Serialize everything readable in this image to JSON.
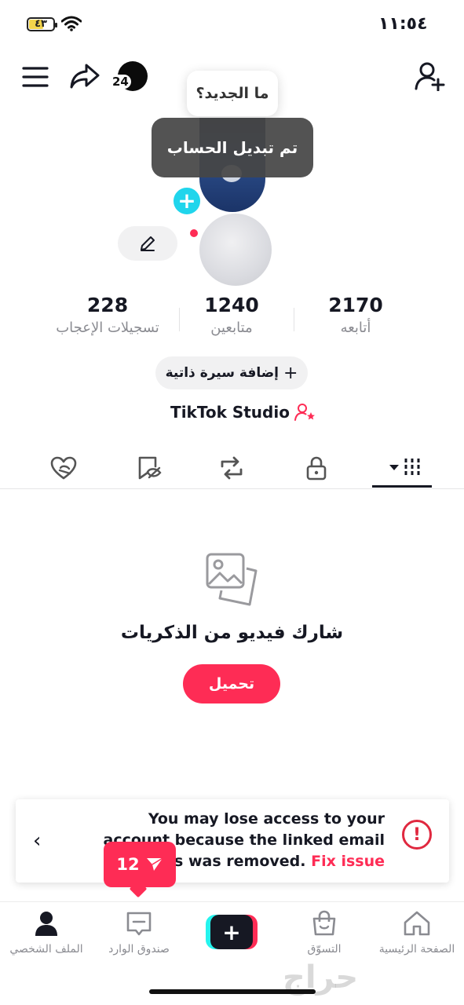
{
  "status_bar": {
    "time": "١١:٥٤",
    "battery": "٤٣"
  },
  "header": {
    "unread_count": "24"
  },
  "profile": {
    "whats_new": "ما الجديد؟",
    "toast": "تم تبديل الحساب"
  },
  "stats": [
    {
      "value": "228",
      "label": "تسجيلات الإعجاب"
    },
    {
      "value": "1240",
      "label": "متابعين"
    },
    {
      "value": "2170",
      "label": "أتابعه"
    }
  ],
  "bio_button": "إضافة سيرة ذاتية",
  "studio_label": "TikTok Studio",
  "empty_state": {
    "title": "شارك فيديو من الذكريات",
    "button": "تحميل"
  },
  "banner": {
    "message": "You may lose access to your account because the linked email address was removed.",
    "action": "Fix issue"
  },
  "inbox_badge": "12",
  "nav": {
    "home": "الصفحة الرئيسية",
    "shop": "التسوّق",
    "inbox": "صندوق الوارد",
    "profile": "الملف الشخصي"
  },
  "watermark": "حراج",
  "colors": {
    "accent": "#fe2c55",
    "cyan": "#25f4ee",
    "text": "#161823",
    "muted": "#8a8b91"
  }
}
